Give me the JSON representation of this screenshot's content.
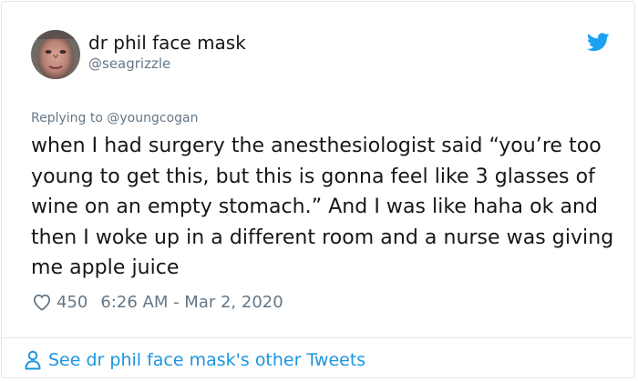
{
  "user": {
    "display_name": "dr phil face mask",
    "handle": "@seagrizzle"
  },
  "reply": {
    "prefix": "Replying to ",
    "mention": "@youngcogan"
  },
  "tweet": {
    "text": "when I had surgery the anesthesiologist said “you’re too young to get this, but this is gonna feel like 3 glasses of wine on an empty stomach.” And I was like haha ok and then I woke up in a different room and a nurse was giving me apple juice"
  },
  "meta": {
    "likes": "450",
    "timestamp": "6:26 AM - Mar 2, 2020"
  },
  "footer": {
    "link_text": "See dr phil face mask's other Tweets"
  },
  "icons": {
    "brand": "twitter-bird-icon",
    "like": "heart-icon",
    "profile": "person-icon"
  },
  "colors": {
    "accent": "#1b95e0",
    "twitter_blue": "#1da1f2",
    "muted": "#657786",
    "text": "#14171a",
    "border": "#e1e8ed"
  }
}
